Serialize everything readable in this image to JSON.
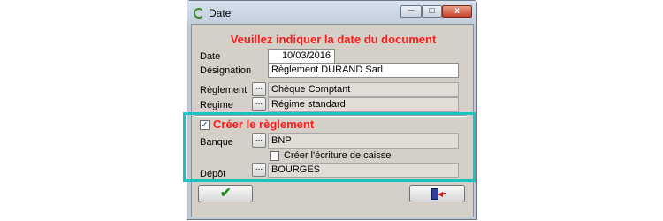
{
  "window": {
    "title": "Date",
    "controls": {
      "minimize": "─",
      "maximize": "□",
      "close": "x"
    }
  },
  "form": {
    "heading": "Veuillez indiquer la date du document",
    "date": {
      "label": "Date",
      "value": "10/03/2016"
    },
    "designation": {
      "label": "Désignation",
      "value": "Règlement DURAND Sarl"
    },
    "reglement": {
      "label": "Règlement",
      "value": "Chèque Comptant",
      "button": "..."
    },
    "regime": {
      "label": "Régime",
      "value": "Régime standard",
      "button": "..."
    }
  },
  "payment_section": {
    "checkbox_checked": true,
    "checkbox_mark": "✓",
    "title": "Créer le règlement",
    "banque": {
      "label": "Banque",
      "value": "BNP",
      "button": "..."
    },
    "ecriture_caisse": {
      "label": "Créer l'écriture de caisse",
      "checked": false
    },
    "depot": {
      "label": "Dépôt",
      "value": "BOURGES",
      "button": "..."
    }
  },
  "footer": {
    "ok_icon": "check-icon",
    "ok_glyph": "✔",
    "exit_icon": "exit-door-icon"
  },
  "highlight_color": "#1bc2c2"
}
